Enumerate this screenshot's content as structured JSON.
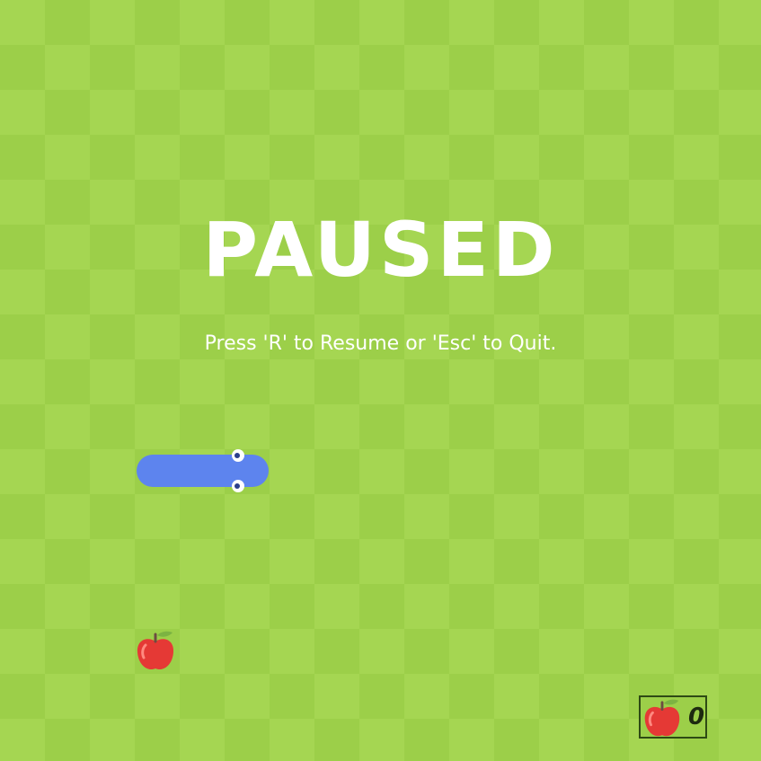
{
  "overlay": {
    "title": "PAUSED",
    "hint": "Press 'R' to Resume or 'Esc' to Quit."
  },
  "score": {
    "value": "0"
  },
  "colors": {
    "board_light": "#a5d652",
    "board_dark": "#9ccf49",
    "snake": "#5d84ee",
    "apple": "#e53935",
    "text": "#ffffff"
  },
  "icons": {
    "food": "apple-icon",
    "score": "apple-icon"
  }
}
